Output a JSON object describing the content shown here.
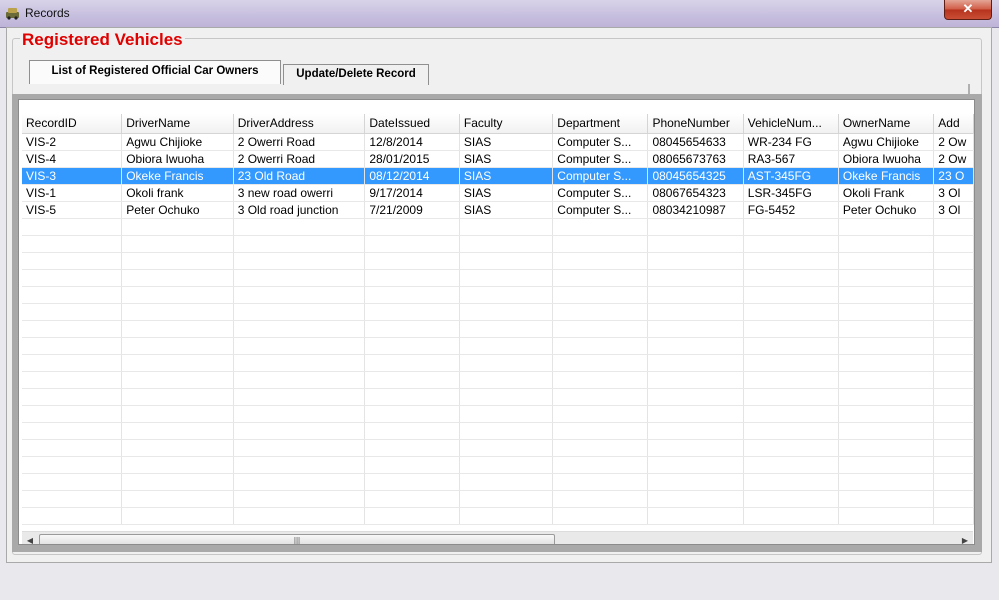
{
  "window": {
    "title": "Records",
    "close_label": "✕"
  },
  "group": {
    "title": "Registered Vehicles"
  },
  "tabs": [
    {
      "label": "List of Registered Official Car Owners",
      "active": true
    },
    {
      "label": "Update/Delete Record",
      "active": false
    }
  ],
  "grid": {
    "columns": [
      "RecordID",
      "DriverName",
      "DriverAddress",
      "DateIssued",
      "Faculty",
      "Department",
      "PhoneNumber",
      "VehicleNum...",
      "OwnerName",
      "Add"
    ],
    "rows": [
      [
        "VIS-2",
        "Agwu Chijioke",
        "2 Owerri Road",
        "12/8/2014",
        "SIAS",
        "Computer S...",
        "08045654633",
        "WR-234 FG",
        "Agwu Chijioke",
        "2 Ow"
      ],
      [
        "VIS-4",
        "Obiora Iwuoha",
        "2 Owerri Road",
        "28/01/2015",
        "SIAS",
        "Computer S...",
        "08065673763",
        "RA3-567",
        "Obiora Iwuoha",
        "2 Ow"
      ],
      [
        "VIS-3",
        "Okeke Francis",
        "23 Old Road",
        "08/12/2014",
        "SIAS",
        "Computer S...",
        "08045654325",
        "AST-345FG",
        "Okeke Francis",
        "23 O"
      ],
      [
        "VIS-1",
        "Okoli frank",
        "3 new road owerri",
        "9/17/2014",
        "SIAS",
        "Computer S...",
        "08067654323",
        "LSR-345FG",
        "Okoli Frank",
        "3 Ol"
      ],
      [
        "VIS-5",
        "Peter Ochuko",
        "3 Old road junction",
        "7/21/2009",
        "SIAS",
        "Computer S...",
        "08034210987",
        "FG-5452",
        "Peter Ochuko",
        "3 Ol"
      ]
    ],
    "selected_row": 2,
    "empty_rows": 18
  },
  "scrollbar": {
    "left_arrow": "◀",
    "right_arrow": "▶",
    "thumb_grip": "|||"
  },
  "colors": {
    "title_red": "#e00000",
    "selection": "#3399ff"
  }
}
